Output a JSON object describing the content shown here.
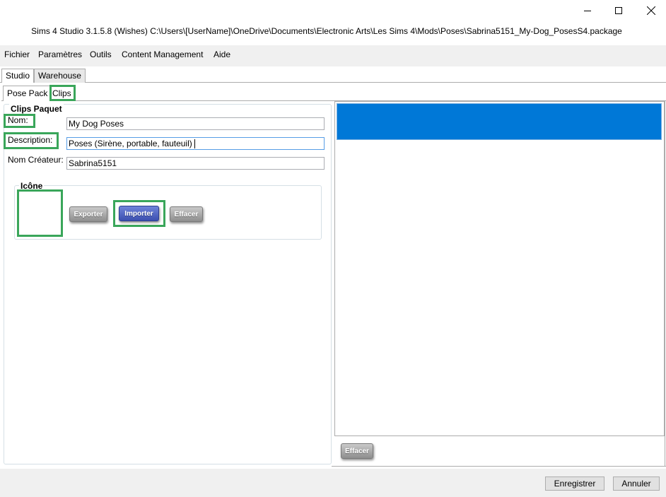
{
  "window": {
    "title": "Sims 4 Studio 3.1.5.8 (Wishes)  C:\\Users\\[UserName]\\OneDrive\\Documents\\Electronic Arts\\Les Sims 4\\Mods\\Poses\\Sabrina5151_My-Dog_PosesS4.package"
  },
  "menu": {
    "items": [
      "Fichier",
      "Paramètres",
      "Outils",
      "Content Management",
      "Aide"
    ]
  },
  "main_tabs": [
    "Studio",
    "Warehouse"
  ],
  "sub_tabs": [
    "Pose Pack",
    "Clips"
  ],
  "clips_paquet": {
    "title": "Clips Paquet",
    "name_label": "Nom:",
    "name_value": "My Dog Poses",
    "description_label": "Description:",
    "description_value": "Poses (Sirène, portable, fauteuil)",
    "creator_label": "Nom Créateur:",
    "creator_value": "Sabrina5151"
  },
  "icon_group": {
    "title": "Icône",
    "export_label": "Exporter",
    "import_label": "Importer",
    "clear_label": "Effacer"
  },
  "right_panel": {
    "clear_label": "Effacer"
  },
  "footer": {
    "save_label": "Enregistrer",
    "cancel_label": "Annuler"
  },
  "colors": {
    "selection": "#0078d7",
    "highlight": "#3aa65a"
  }
}
